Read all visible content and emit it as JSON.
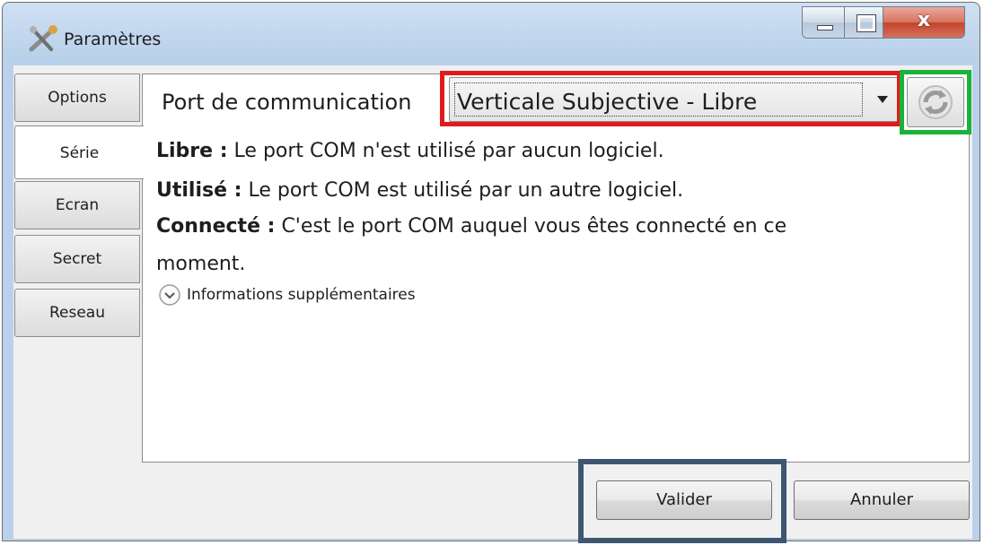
{
  "window": {
    "title": "Paramètres"
  },
  "tabs": [
    {
      "label": "Options"
    },
    {
      "label": "Série"
    },
    {
      "label": "Ecran"
    },
    {
      "label": "Secret"
    },
    {
      "label": "Reseau"
    }
  ],
  "serie": {
    "port_label": "Port de communication",
    "port_value": "Verticale Subjective - Libre",
    "legend": [
      {
        "term": "Libre :",
        "desc": " Le port COM n'est utilisé par aucun logiciel."
      },
      {
        "term": "Utilisé :",
        "desc": " Le port COM est utilisé par un autre logiciel."
      },
      {
        "term": "Connecté :",
        "desc": " C'est le port COM auquel vous êtes connecté en ce"
      },
      {
        "term": "",
        "desc": "moment."
      }
    ],
    "more_info": "Informations supplémentaires"
  },
  "buttons": {
    "ok": "Valider",
    "cancel": "Annuler"
  },
  "colors": {
    "highlight_combo": "#e11b1b",
    "highlight_refresh": "#1bb13a",
    "highlight_ok": "#3e5672"
  }
}
